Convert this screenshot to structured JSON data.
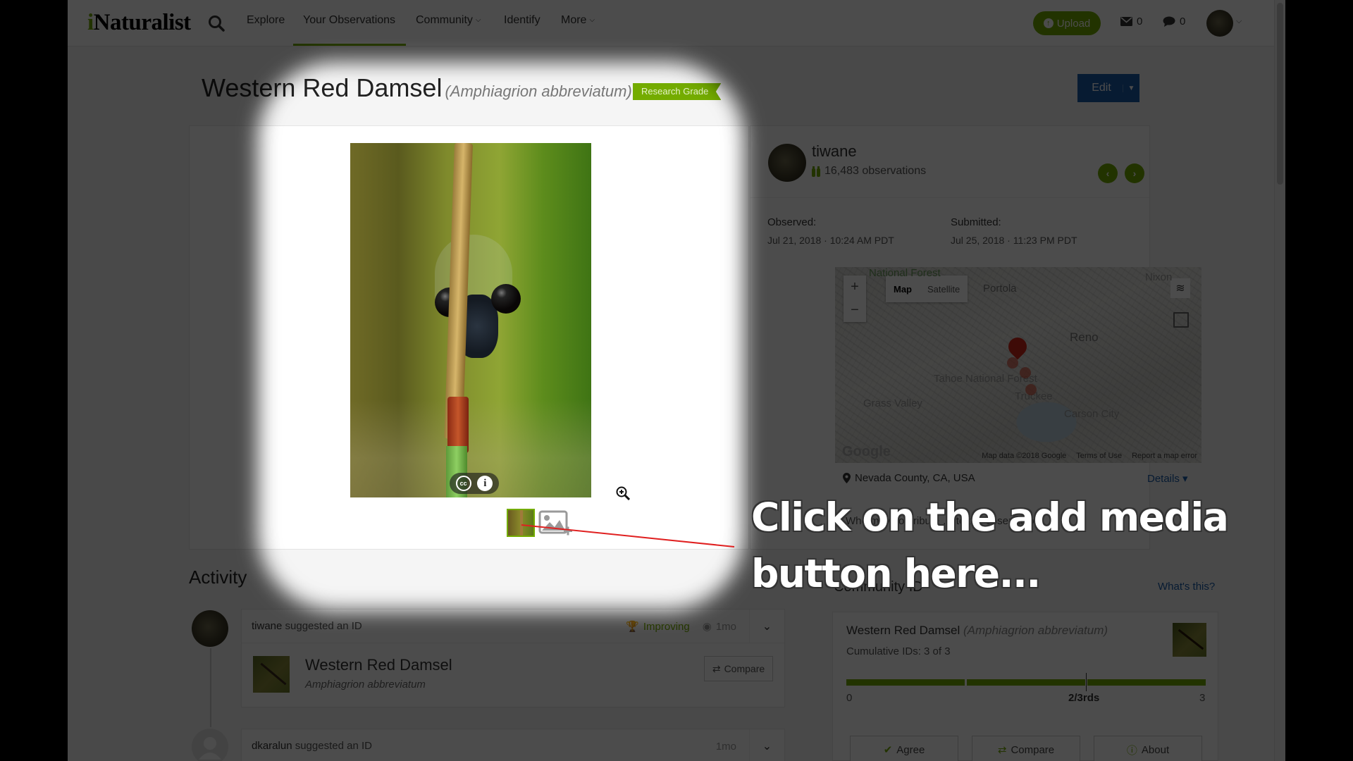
{
  "nav": {
    "logo_initial": "i",
    "logo_rest": "Naturalist",
    "links": [
      {
        "label": "Explore",
        "dropdown": false
      },
      {
        "label": "Your Observations",
        "dropdown": false,
        "active": true
      },
      {
        "label": "Community",
        "dropdown": true
      },
      {
        "label": "Identify",
        "dropdown": false
      },
      {
        "label": "More",
        "dropdown": true
      }
    ],
    "upload_label": "Upload",
    "messages_count": "0",
    "notifications_count": "0",
    "caret": "⌄"
  },
  "observation": {
    "common_name": "Western Red Damsel",
    "scientific_name": "(Amphiagrion abbreviatum)",
    "quality_grade": "Research Grade",
    "edit_label": "Edit",
    "photo_license_icon": "cc",
    "photo_info_icon": "i"
  },
  "observer": {
    "username": "tiwane",
    "observations_count": "16,483 observations",
    "prev_icon": "‹",
    "next_icon": "›"
  },
  "meta": {
    "observed_label": "Observed:",
    "observed_value": "Jul 21, 2018 · 10:24 AM PDT",
    "submitted_label": "Submitted:",
    "submitted_value": "Jul 25, 2018 · 11:23 PM PDT"
  },
  "map": {
    "zoom_in": "+",
    "zoom_out": "−",
    "type_map": "Map",
    "type_satellite": "Satellite",
    "labels": [
      "National Forest",
      "Portola",
      "Reno",
      "Tahoe National Forest",
      "Grass Valley",
      "Carson City",
      "Nixon",
      "Truckee"
    ],
    "attribution": "Map data ©2018 Google",
    "terms": "Terms of Use",
    "report": "Report a map error",
    "google": "Google",
    "place": "Nevada County, CA, USA",
    "details_label": "Details ▾"
  },
  "contribution": {
    "text": "Who may contribute … to the observation"
  },
  "community_id": {
    "heading": "Community ID",
    "whats_this": "What's this?",
    "taxon_common": "Western Red Damsel",
    "taxon_sci": "(Amphiagrion abbreviatum)",
    "cumulative": "Cumulative IDs: 3 of 3",
    "agreement_fraction": 1.0,
    "tick_min": "0",
    "tick_mid": "2/3rds",
    "tick_max": "3",
    "agree_label": "Agree",
    "compare_label": "Compare",
    "about_label": "About"
  },
  "activity": {
    "heading": "Activity",
    "items": [
      {
        "user": "tiwane",
        "action": " suggested an ID",
        "status": "Improving",
        "time": "1mo",
        "taxon_common": "Western Red Damsel",
        "taxon_sci": "Amphiagrion abbreviatum",
        "compare_label": "Compare"
      },
      {
        "user": "dkaralun",
        "action": " suggested an ID",
        "time": "1mo"
      }
    ]
  },
  "tutorial": {
    "callout_line1": "Click on the add media",
    "callout_line2": "button here...",
    "line_color": "#e02020"
  }
}
